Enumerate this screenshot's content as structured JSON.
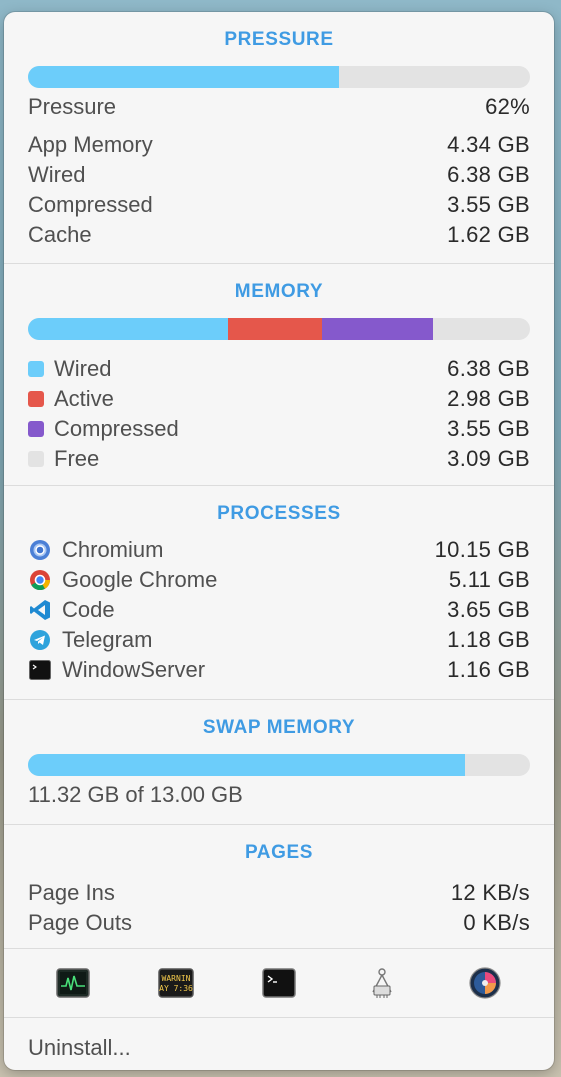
{
  "pressure": {
    "title": "PRESSURE",
    "percent": 62,
    "bar_color": "#6ccdfa",
    "rows": [
      {
        "label": "Pressure",
        "value": "62%"
      },
      {
        "label": "App Memory",
        "value": "4.34 GB"
      },
      {
        "label": "Wired",
        "value": "6.38 GB"
      },
      {
        "label": "Compressed",
        "value": "3.55 GB"
      },
      {
        "label": "Cache",
        "value": "1.62 GB"
      }
    ]
  },
  "memory": {
    "title": "MEMORY",
    "total_gb": 16.0,
    "items": [
      {
        "label": "Wired",
        "value": "6.38 GB",
        "gb": 6.38,
        "color": "#6ccdfa"
      },
      {
        "label": "Active",
        "value": "2.98 GB",
        "gb": 2.98,
        "color": "#e5574b"
      },
      {
        "label": "Compressed",
        "value": "3.55 GB",
        "gb": 3.55,
        "color": "#8559cc"
      },
      {
        "label": "Free",
        "value": "3.09 GB",
        "gb": 3.09,
        "color": "#e3e3e3"
      }
    ]
  },
  "processes": {
    "title": "PROCESSES",
    "items": [
      {
        "icon": "chromium-icon",
        "name": "Chromium",
        "value": "10.15 GB"
      },
      {
        "icon": "google-chrome-icon",
        "name": "Google Chrome",
        "value": "5.11 GB"
      },
      {
        "icon": "vscode-icon",
        "name": "Code",
        "value": "3.65 GB"
      },
      {
        "icon": "telegram-icon",
        "name": "Telegram",
        "value": "1.18 GB"
      },
      {
        "icon": "terminal-icon",
        "name": "WindowServer",
        "value": "1.16 GB"
      }
    ]
  },
  "swap": {
    "title": "SWAP MEMORY",
    "used_gb": 11.32,
    "total_gb": 13.0,
    "text": "11.32 GB of 13.00 GB",
    "bar_color": "#6ccdfa"
  },
  "pages": {
    "title": "PAGES",
    "rows": [
      {
        "label": "Page Ins",
        "value": "12 KB/s"
      },
      {
        "label": "Page Outs",
        "value": "0 KB/s"
      }
    ]
  },
  "toolbar": {
    "buttons": [
      {
        "icon": "activity-monitor-icon"
      },
      {
        "icon": "console-icon",
        "text_line1": "WARNIN",
        "text_line2": "AY 7:36"
      },
      {
        "icon": "terminal-icon"
      },
      {
        "icon": "system-information-icon"
      },
      {
        "icon": "disk-utility-icon"
      }
    ]
  },
  "footer": {
    "label": "Uninstall..."
  }
}
